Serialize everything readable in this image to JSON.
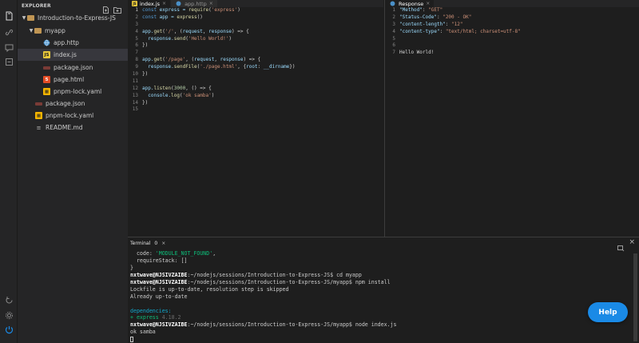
{
  "explorer": {
    "title": "EXPLORER",
    "tree": [
      {
        "label": "Introduction-to-Express-JS",
        "type": "folder",
        "icon": "folder-icon"
      },
      {
        "label": "myapp",
        "type": "folder",
        "icon": "folder-icon"
      },
      {
        "label": "app.http",
        "type": "file",
        "icon": "globe-icon"
      },
      {
        "label": "index.js",
        "type": "file",
        "icon": "js-file-icon"
      },
      {
        "label": "package.json",
        "type": "file",
        "icon": "json-file-icon"
      },
      {
        "label": "page.html",
        "type": "file",
        "icon": "html-file-icon"
      },
      {
        "label": "pnpm-lock.yaml",
        "type": "file",
        "icon": "yaml-file-icon"
      },
      {
        "label": "package.json",
        "type": "file",
        "icon": "json-file-icon"
      },
      {
        "label": "pnpm-lock.yaml",
        "type": "file",
        "icon": "yaml-file-icon"
      },
      {
        "label": "README.md",
        "type": "file",
        "icon": "markdown-file-icon"
      }
    ]
  },
  "editor": {
    "tabs": [
      {
        "label": "index.js",
        "icon": "js-file-icon",
        "active": true
      },
      {
        "label": "app.http",
        "icon": "globe-icon",
        "active": false
      }
    ],
    "line_numbers": [
      "1",
      "2",
      "3",
      "4",
      "5",
      "6",
      "7",
      "8",
      "9",
      "10",
      "11",
      "12",
      "13",
      "14",
      "15"
    ],
    "code": {
      "l1": [
        "const",
        " express = ",
        "require",
        "(",
        "'express'",
        ")"
      ],
      "l2": [
        "const",
        " app = ",
        "express",
        "()"
      ],
      "l4": [
        "app.",
        "get",
        "(",
        "'/'",
        ", (",
        "request",
        ", ",
        "response",
        ") => {"
      ],
      "l5": [
        "response.",
        "send",
        "(",
        "'Hello World!'",
        ")"
      ],
      "l6": [
        "})"
      ],
      "l8": [
        "app.",
        "get",
        "(",
        "'/page'",
        ", (",
        "request",
        ", ",
        "response",
        ") => {"
      ],
      "l9": [
        "response.",
        "sendFile",
        "(",
        "'./page.html'",
        ", {",
        "root",
        ": ",
        "__dirname",
        "})"
      ],
      "l10": [
        "})"
      ],
      "l12": [
        "app.",
        "listen",
        "(",
        "3000",
        ", () => {"
      ],
      "l13": [
        "console.",
        "log",
        "(",
        "'ok samba'",
        ")"
      ],
      "l14": [
        "})"
      ]
    }
  },
  "response": {
    "tab_label": "Response",
    "line_numbers": [
      "1",
      "2",
      "3",
      "4",
      "5",
      "6",
      "7"
    ],
    "lines": [
      {
        "key": "\"Method\"",
        "value": "\"GET\""
      },
      {
        "key": "\"Status-Code\"",
        "value": "\"200 - OK\""
      },
      {
        "key": "\"content-length\"",
        "value": "\"12\""
      },
      {
        "key": "\"content-type\"",
        "value": "\"text/html; charset=utf-8\""
      }
    ],
    "body": "Hello World!"
  },
  "terminal": {
    "tab_label": "Terminal",
    "tab_count": "0",
    "lines": {
      "t1a": "  code: ",
      "t1b": "'MODULE_NOT_FOUND'",
      "t1c": ",",
      "t2": "  requireStack: []",
      "t3": "}",
      "user": "nxtwave@NJSIVZAIBE",
      "path1": ":~/nodejs/sessions/Introduction-to-Express-JS$ ",
      "cmd1": "cd myapp",
      "path2": ":~/nodejs/sessions/Introduction-to-Express-JS/myapp$ ",
      "cmd2": "npm install",
      "t6": "Lockfile is up-to-date, resolution step is skipped",
      "t7": "Already up-to-date",
      "t9": "dependencies:",
      "t10a": "+ express ",
      "t10b": "4.18.2",
      "cmd3": "node index.js",
      "t12": "ok samba"
    }
  },
  "help_button": "Help",
  "colors": {
    "accent_blue": "#1a8ae6",
    "terminal_green": "#0dbc79",
    "terminal_cyan": "#11a8cd",
    "string": "#ce9178",
    "keyword": "#569cd6"
  }
}
